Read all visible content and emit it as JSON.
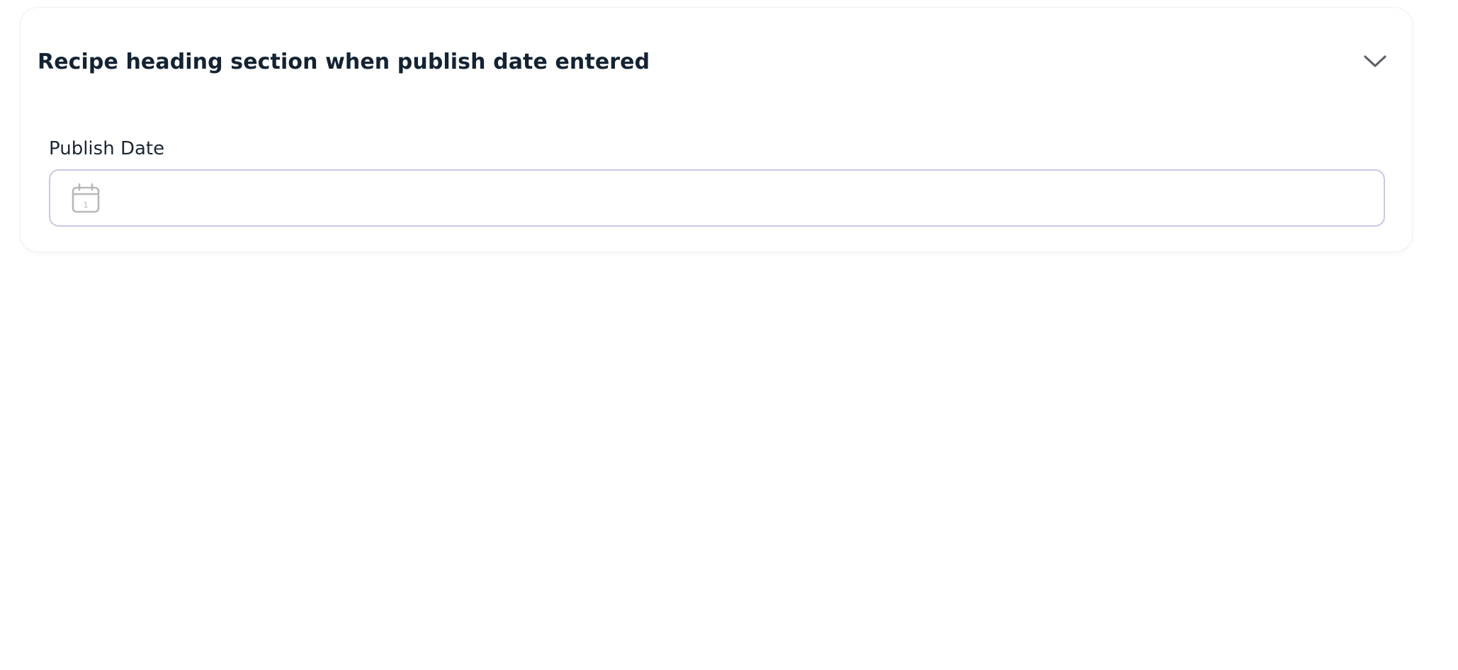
{
  "section": {
    "title": "Recipe heading section when publish date entered",
    "toggle_icon": "chevron-down-icon"
  },
  "publish_date": {
    "label": "Publish Date",
    "value": "",
    "placeholder": "",
    "icon": "calendar-icon",
    "icon_glyph": "1"
  },
  "colors": {
    "title": "#142332",
    "input_border": "#c9c7e3",
    "icon": "#b8b8bc",
    "chevron": "#5d6168"
  }
}
